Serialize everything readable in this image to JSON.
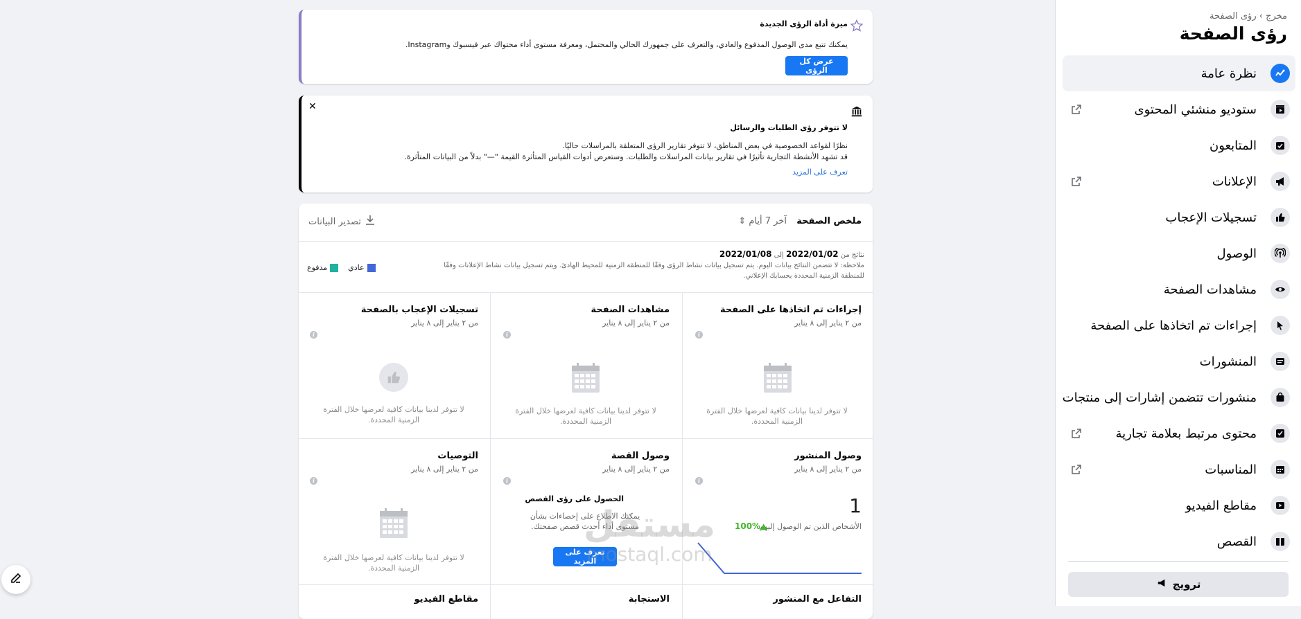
{
  "sidebar": {
    "breadcrumb": "مخرج › رؤى الصفحة",
    "title": "رؤى الصفحة",
    "items": [
      {
        "label": "نظرة عامة",
        "icon": "trend-icon",
        "active": true,
        "external": false
      },
      {
        "label": "ستوديو منشئي المحتوى",
        "icon": "clapper-icon",
        "active": false,
        "external": true
      },
      {
        "label": "المتابعون",
        "icon": "followers-icon",
        "active": false,
        "external": false
      },
      {
        "label": "الإعلانات",
        "icon": "megaphone-icon",
        "active": false,
        "external": true
      },
      {
        "label": "تسجيلات الإعجاب",
        "icon": "thumbs-up-icon",
        "active": false,
        "external": false
      },
      {
        "label": "الوصول",
        "icon": "broadcast-icon",
        "active": false,
        "external": false
      },
      {
        "label": "مشاهدات الصفحة",
        "icon": "eye-icon",
        "active": false,
        "external": false
      },
      {
        "label": "إجراءات تم اتخاذها على الصفحة",
        "icon": "cursor-icon",
        "active": false,
        "external": false
      },
      {
        "label": "المنشورات",
        "icon": "posts-icon",
        "active": false,
        "external": false
      },
      {
        "label": "منشورات تتضمن إشارات إلى منتجات",
        "icon": "shopping-bag-icon",
        "active": false,
        "external": false
      },
      {
        "label": "محتوى مرتبط بعلامة تجارية",
        "icon": "checklist-icon",
        "active": false,
        "external": true
      },
      {
        "label": "المناسبات",
        "icon": "calendar-icon",
        "active": false,
        "external": true
      },
      {
        "label": "مقاطع الفيديو",
        "icon": "play-icon",
        "active": false,
        "external": false
      },
      {
        "label": "القصص",
        "icon": "book-icon",
        "active": false,
        "external": false
      }
    ],
    "promote_label": "ترويج"
  },
  "banner1": {
    "title": "ميزة أداة الرؤى الجديدة",
    "text": "يمكنك تتبع مدى الوصول المدفوع والعادي، والتعرف على جمهورك الحالي والمحتمل، ومعرفة مستوى أداء محتواك عبر فيسبوك وInstagram.",
    "button": "عرض كل الرؤى"
  },
  "banner2": {
    "title": "لا تتوفر رؤى الطلبات والرسائل",
    "line1": "نظرًا لقواعد الخصوصية في بعض المناطق، لا تتوفر تقارير الرؤى المتعلقة بالمراسلات حاليًا.",
    "line2": "قد تشهد الأنشطة التجارية تأثيرًا في تقارير بيانات المراسلات والطلبات. وستعرض أدوات القياس المتأثرة القيمة \"—\" بدلاً من البيانات المتأثرة.",
    "link": "تعرف على المزيد",
    "close": "✕"
  },
  "summary": {
    "title": "ملخص الصفحة",
    "period": "آخر 7 أيام ⇕",
    "export": "تصدير البيانات",
    "results_prefix": "نتائج من",
    "date_from": "2022/01/02",
    "date_to_word": "إلى",
    "date_to": "2022/01/08",
    "note": "ملاحظة: لا تتضمن النتائج بيانات اليوم. يتم تسجيل بيانات نشاط الرؤى وفقًا للمنطقة الزمنية للمحيط الهادئ. ويتم تسجيل بيانات نشاط الإعلانات وفقًا للمنطقة الزمنية المحددة بحسابك الإعلاني.",
    "legend_organic": "عادي",
    "legend_paid": "مدفوع",
    "color_organic": "#4267d6",
    "color_paid": "#20b2a0",
    "empty_msg": "لا تتوفر لدينا بيانات كافية لعرضها خلال الفترة الزمنية المحددة.",
    "date_range": "من ٢ يناير إلى ٨ يناير",
    "cells": {
      "actions": "إجراءات تم اتخاذها على الصفحة",
      "views": "مشاهدات الصفحة",
      "likes": "تسجيلات الإعجاب بالصفحة",
      "post_reach": "وصول المنشور",
      "story_reach": "وصول القصة",
      "recommendations": "التوصيات",
      "engagement": "التفاعل مع المنشور",
      "responsiveness": "الاستجابة",
      "videos": "مقاطع الفيديو"
    },
    "post_reach": {
      "value": "1",
      "desc": "الأشخاص الذين تم الوصول إليهم",
      "pct": "▲100%"
    },
    "story": {
      "title": "الحصول على رؤى القصص",
      "text": "يمكنك الاطلاع على إحصاءات بشأن مستوى أداء أحدث قصص صفحتك.",
      "button": "تعرف على المزيد"
    }
  },
  "watermark": {
    "ar": "مستقل",
    "en": "mostaql.com"
  }
}
